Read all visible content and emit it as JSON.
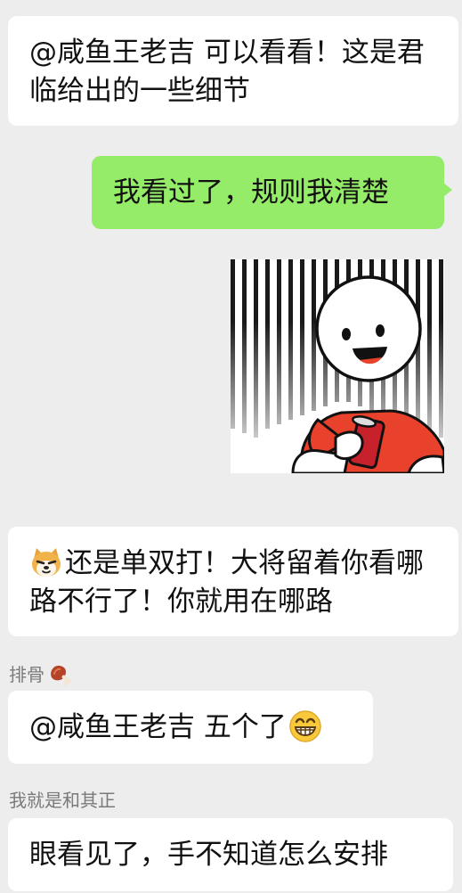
{
  "messages": [
    {
      "text": "@咸鱼王老吉 可以看看！这是君临给出的一些细节"
    },
    {
      "text": "我看过了，规则我清楚"
    },
    {
      "sticker": "smiling-stickman-red-shirt-holding-can"
    },
    {
      "text": "还是单双打！大将留着你看哪路不行了！你就用在哪路",
      "emoji_prefix": "doge-emoji"
    },
    {
      "sender": "排骨",
      "sender_emoji": "meat-bone-emoji",
      "text": "@咸鱼王老吉 五个了",
      "emoji_suffix": "grinning-emoji"
    },
    {
      "sender": "我就是和其正",
      "text": "眼看见了，手不知道怎么安排"
    }
  ],
  "colors": {
    "background": "#ededed",
    "incoming_bubble": "#ffffff",
    "outgoing_bubble": "#95ec69",
    "sticker_shirt": "#e8412c",
    "sticker_can": "#c7212b"
  }
}
